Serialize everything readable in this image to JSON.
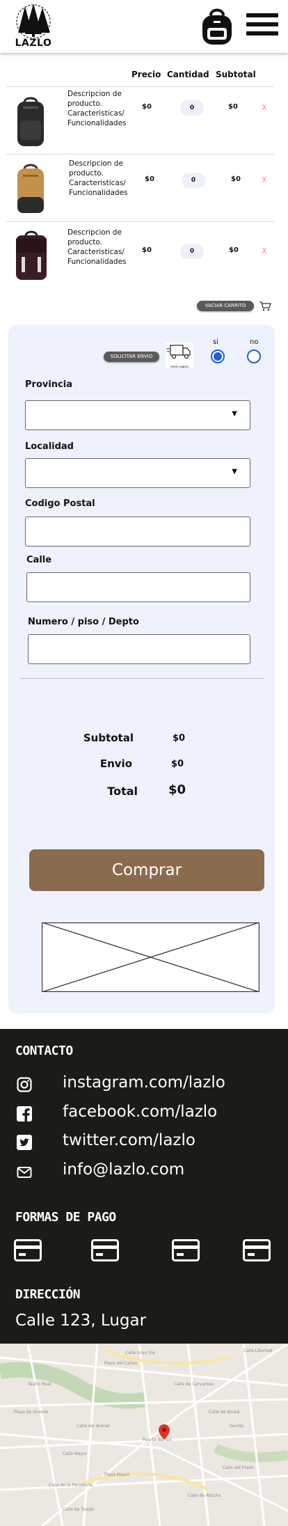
{
  "header": {
    "logo_text": "LAZLO",
    "cart_icon": "backpack-icon",
    "menu_icon": "hamburger-menu-icon"
  },
  "cart": {
    "columns": {
      "price": "Precio",
      "quantity": "Cantidad",
      "subtotal": "Subtotal"
    },
    "items": [
      {
        "description": "Descripcion de producto. Caracteristicas/ Funcionalidades",
        "price": "$0",
        "quantity": "0",
        "subtotal": "$0",
        "remove": "X",
        "image_icon": "black-backpack-image"
      },
      {
        "description": "Descripcion de producto. Caracteristicas/ Funcionalidades",
        "price": "$0",
        "quantity": "0",
        "subtotal": "$0",
        "remove": "X",
        "image_icon": "tan-backpack-image"
      },
      {
        "description": "Descripcion de producto. Caracteristicas/ Funcionalidades",
        "price": "$0",
        "quantity": "0",
        "subtotal": "$0",
        "remove": "X",
        "image_icon": "maroon-backpack-image"
      }
    ],
    "clear_label": "VACIAR CARRITO",
    "trash_icon": "cart-trash-icon"
  },
  "shipping": {
    "request_label": "SOLICITAR ENVIO",
    "truck_icon": "delivery-truck-icon",
    "truck_caption": "envio seguro",
    "option_yes": "si",
    "option_no": "no",
    "province_label": "Provincia",
    "locality_label": "Localidad",
    "postal_label": "Codigo Postal",
    "street_label": "Calle",
    "number_label": "Numero / piso / Depto"
  },
  "summary": {
    "subtotal_label": "Subtotal",
    "subtotal_value": "$0",
    "shipping_label": "Envio",
    "shipping_value": "$0",
    "total_label": "Total",
    "total_value": "$0",
    "buy_label": "Comprar"
  },
  "footer": {
    "contact_title": "CONTACTO",
    "contacts": [
      {
        "icon": "instagram-icon",
        "text": "instagram.com/lazlo"
      },
      {
        "icon": "facebook-icon",
        "text": "facebook.com/lazlo"
      },
      {
        "icon": "twitter-icon",
        "text": "twitter.com/lazlo"
      },
      {
        "icon": "envelope-icon",
        "text": "info@lazlo.com"
      }
    ],
    "payment_title": "FORMAS DE PAGO",
    "payment_icon": "credit-card-icon",
    "address_title": "DIRECCIÓN",
    "address": "Calle 123, Lugar"
  },
  "map": {
    "labels": [
      "Calle Gran Via",
      "Plaza del Callao",
      "Calle Libertad",
      "Puerta del Sol",
      "Teatro Real",
      "Calle Mayor",
      "Plaza de Oriente",
      "Calle de Atocha",
      "Calle de Alcalá",
      "Calle del Prado",
      "Plaza Mayor",
      "Sevilla",
      "Calle de Cervantes",
      "Calle del Arenal",
      "Calle de Toledo",
      "Casa de la Panadería"
    ]
  }
}
